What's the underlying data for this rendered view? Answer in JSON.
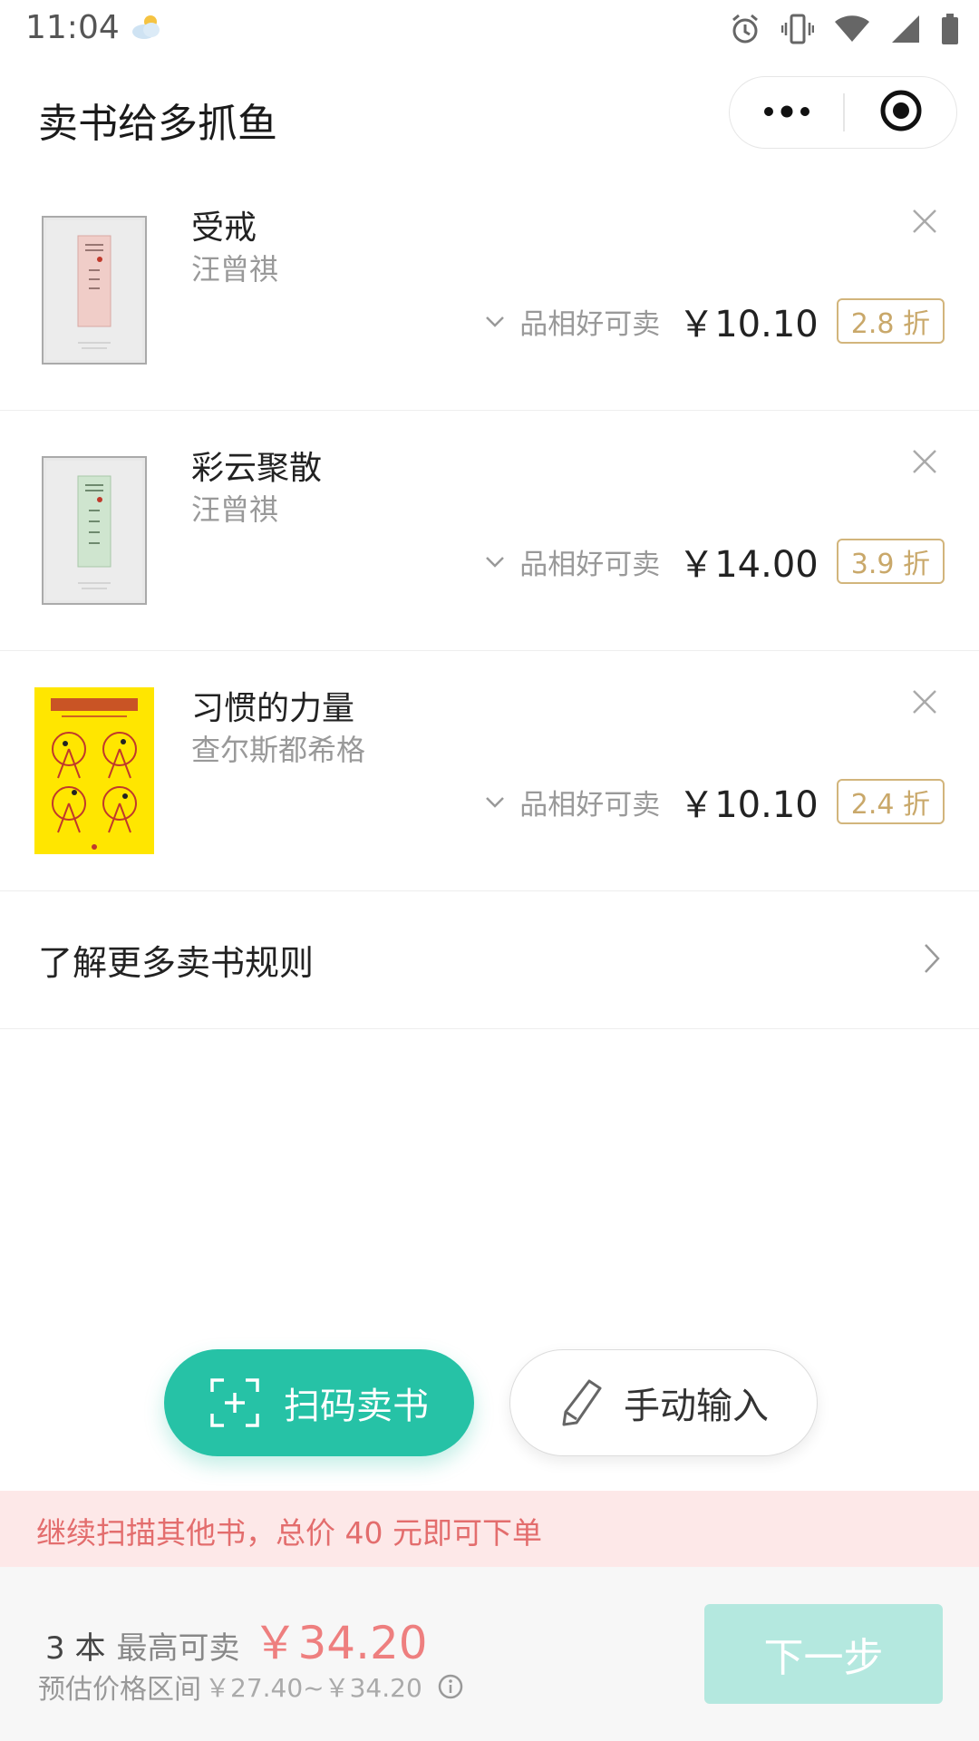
{
  "status_bar": {
    "time": "11:04",
    "icons": [
      "weather-partly-cloudy-icon",
      "alarm-icon",
      "vibrate-icon",
      "wifi-icon",
      "signal-icon",
      "battery-icon"
    ]
  },
  "nav": {
    "title": "卖书给多抓鱼",
    "more_icon": "more-dots-icon",
    "close_icon": "target-circle-icon"
  },
  "books": [
    {
      "title": "受戒",
      "author": "汪曾祺",
      "condition": "品相好可卖",
      "price": "￥10.10",
      "discount": "2.8 折",
      "cover_color": "#e9e9e9"
    },
    {
      "title": "彩云聚散",
      "author": "汪曾祺",
      "condition": "品相好可卖",
      "price": "￥14.00",
      "discount": "3.9 折",
      "cover_color": "#e9e9e9"
    },
    {
      "title": "习惯的力量",
      "author": "查尔斯都希格",
      "condition": "品相好可卖",
      "price": "￥10.10",
      "discount": "2.4 折",
      "cover_color": "#ffe600"
    }
  ],
  "rules": {
    "label": "了解更多卖书规则"
  },
  "actions": {
    "scan_label": "扫码卖书",
    "manual_label": "手动输入"
  },
  "notice": {
    "text": "继续扫描其他书，总价 40 元即可下单"
  },
  "summary": {
    "count": "3 本",
    "max_label": "最高可卖",
    "max_price": "￥34.20",
    "range_label": "预估价格区间",
    "range_value": "￥27.40~￥34.20",
    "next_label": "下一步"
  },
  "colors": {
    "accent": "#26c2a6",
    "discount_gold": "#c9a86a",
    "notice_red": "#e36d6d",
    "price_red": "#ee7f7f"
  }
}
